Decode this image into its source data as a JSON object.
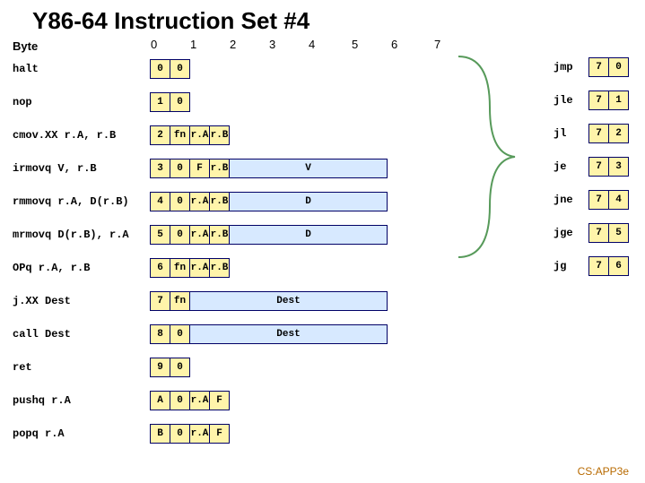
{
  "title": "Y86-64 Instruction Set #4",
  "byte_label": "Byte",
  "columns": [
    "0",
    "1",
    "2",
    "3",
    "4",
    "5",
    "6",
    "7"
  ],
  "instructions": [
    {
      "name": "halt",
      "bytes": [
        [
          "0",
          "0"
        ]
      ]
    },
    {
      "name": "nop",
      "bytes": [
        [
          "1",
          "0"
        ]
      ]
    },
    {
      "name": "cmov.XX r.A, r.B",
      "bytes": [
        [
          "2",
          "fn"
        ],
        [
          "r.A",
          "r.B"
        ]
      ]
    },
    {
      "name": "irmovq V, r.B",
      "bytes": [
        [
          "3",
          "0"
        ],
        [
          "F",
          "r.B"
        ]
      ],
      "tail": "V"
    },
    {
      "name": "rmmovq r.A, D(r.B)",
      "bytes": [
        [
          "4",
          "0"
        ],
        [
          "r.A",
          "r.B"
        ]
      ],
      "tail": "D"
    },
    {
      "name": "mrmovq D(r.B), r.A",
      "bytes": [
        [
          "5",
          "0"
        ],
        [
          "r.A",
          "r.B"
        ]
      ],
      "tail": "D"
    },
    {
      "name": "OPq r.A, r.B",
      "bytes": [
        [
          "6",
          "fn"
        ],
        [
          "r.A",
          "r.B"
        ]
      ]
    },
    {
      "name": "j.XX Dest",
      "bytes": [
        [
          "7",
          "fn"
        ]
      ],
      "dest": "Dest"
    },
    {
      "name": "call Dest",
      "bytes": [
        [
          "8",
          "0"
        ]
      ],
      "dest": "Dest"
    },
    {
      "name": "ret",
      "bytes": [
        [
          "9",
          "0"
        ]
      ]
    },
    {
      "name": "pushq r.A",
      "bytes": [
        [
          "A",
          "0"
        ],
        [
          "r.A",
          "F"
        ]
      ]
    },
    {
      "name": "popq r.A",
      "bytes": [
        [
          "B",
          "0"
        ],
        [
          "r.A",
          "F"
        ]
      ]
    }
  ],
  "jumps": [
    {
      "name": "jmp",
      "code": [
        "7",
        "0"
      ]
    },
    {
      "name": "jle",
      "code": [
        "7",
        "1"
      ]
    },
    {
      "name": "jl",
      "code": [
        "7",
        "2"
      ]
    },
    {
      "name": "je",
      "code": [
        "7",
        "3"
      ]
    },
    {
      "name": "jne",
      "code": [
        "7",
        "4"
      ]
    },
    {
      "name": "jge",
      "code": [
        "7",
        "5"
      ]
    },
    {
      "name": "jg",
      "code": [
        "7",
        "6"
      ]
    }
  ],
  "credit": "CS:APP3e"
}
